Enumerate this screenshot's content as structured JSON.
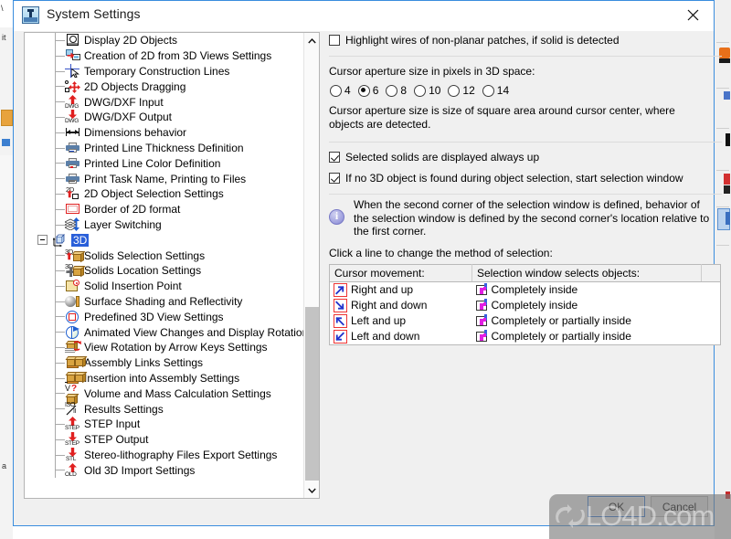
{
  "window": {
    "title": "System Settings",
    "app_icon": "app-window-icon",
    "close_label": "×"
  },
  "tree": {
    "items": [
      {
        "label": "Display 2D Objects",
        "icon": "display-2d-objects-icon",
        "selected": false,
        "indent": 1
      },
      {
        "label": "Creation of 2D from 3D Views Settings",
        "icon": "creation-2d-from-3d-icon",
        "selected": false,
        "indent": 1
      },
      {
        "label": "Temporary Construction Lines",
        "icon": "construction-lines-icon",
        "selected": false,
        "indent": 1
      },
      {
        "label": "2D Objects Dragging",
        "icon": "objects-dragging-icon",
        "selected": false,
        "indent": 1
      },
      {
        "label": "DWG/DXF Input",
        "icon": "dwg-input-icon",
        "selected": false,
        "indent": 1
      },
      {
        "label": "DWG/DXF Output",
        "icon": "dwg-output-icon",
        "selected": false,
        "indent": 1
      },
      {
        "label": "Dimensions behavior",
        "icon": "dimensions-behavior-icon",
        "selected": false,
        "indent": 1
      },
      {
        "label": "Printed Line Thickness Definition",
        "icon": "printer-thickness-icon",
        "selected": false,
        "indent": 1
      },
      {
        "label": "Printed Line Color Definition",
        "icon": "printer-color-icon",
        "selected": false,
        "indent": 1
      },
      {
        "label": "Print Task Name, Printing to Files",
        "icon": "printer-task-icon",
        "selected": false,
        "indent": 1
      },
      {
        "label": "2D Object Selection Settings",
        "icon": "2d-object-selection-icon",
        "selected": false,
        "indent": 1
      },
      {
        "label": "Border of 2D format",
        "icon": "border-2d-format-icon",
        "selected": false,
        "indent": 1
      },
      {
        "label": "Layer Switching",
        "icon": "layer-switching-icon",
        "selected": false,
        "indent": 1
      },
      {
        "label": "3D",
        "icon": "3d-group-icon",
        "selected": true,
        "indent": 0
      },
      {
        "label": "Solids Selection Settings",
        "icon": "solids-selection-icon",
        "selected": false,
        "indent": 1
      },
      {
        "label": "Solids Location Settings",
        "icon": "solids-location-icon",
        "selected": false,
        "indent": 1
      },
      {
        "label": "Solid Insertion Point",
        "icon": "solid-insertion-point-icon",
        "selected": false,
        "indent": 1
      },
      {
        "label": "Surface Shading and Reflectivity",
        "icon": "surface-shading-icon",
        "selected": false,
        "indent": 1
      },
      {
        "label": "Predefined 3D View Settings",
        "icon": "predefined-3d-view-icon",
        "selected": false,
        "indent": 1
      },
      {
        "label": "Animated View Changes and Display Rotation",
        "icon": "animated-view-icon",
        "selected": false,
        "indent": 1
      },
      {
        "label": "View Rotation by Arrow Keys Settings",
        "icon": "view-rotation-arrows-icon",
        "selected": false,
        "indent": 1
      },
      {
        "label": "Assembly Links Settings",
        "icon": "assembly-links-icon",
        "selected": false,
        "indent": 1
      },
      {
        "label": "Insertion into Assembly Settings",
        "icon": "insertion-assembly-icon",
        "selected": false,
        "indent": 1
      },
      {
        "label": "Volume and Mass Calculation Settings",
        "icon": "volume-mass-icon",
        "selected": false,
        "indent": 1
      },
      {
        "label": "Results Settings",
        "icon": "results-settings-icon",
        "selected": false,
        "indent": 1
      },
      {
        "label": "STEP Input",
        "icon": "step-input-icon",
        "selected": false,
        "indent": 1
      },
      {
        "label": "STEP Output",
        "icon": "step-output-icon",
        "selected": false,
        "indent": 1
      },
      {
        "label": "Stereo-lithography Files Export Settings",
        "icon": "stl-export-icon",
        "selected": false,
        "indent": 1
      },
      {
        "label": "Old 3D Import Settings",
        "icon": "old-3d-import-icon",
        "selected": false,
        "indent": 1
      }
    ],
    "scrollbar": {
      "up_arrow": "∧",
      "down_arrow": "∨"
    }
  },
  "settings": {
    "highlight_wires": {
      "label": "Highlight wires of non-planar patches, if solid is detected",
      "checked": false
    },
    "aperture_heading": "Cursor aperture size in pixels in 3D space:",
    "aperture_options": [
      "4",
      "6",
      "8",
      "10",
      "12",
      "14"
    ],
    "aperture_selected": "6",
    "aperture_help": "Cursor aperture size is size of square area around cursor center, where objects are detected.",
    "selected_solids_up": {
      "label": "Selected solids are displayed always up",
      "checked": true
    },
    "start_selection_window": {
      "label": "If no 3D object is found during object selection, start selection window",
      "checked": true
    },
    "info_text": "When the second corner of the selection window is defined, behavior of the selection window is defined by the second corner's location relative to the first corner.",
    "click_line_label": "Click a line to change the method of selection:"
  },
  "selection_table": {
    "headers": [
      "Cursor movement:",
      "Selection window selects objects:",
      ""
    ],
    "rows": [
      {
        "movement": "Right and up",
        "arrow": "arrow-up-right-icon",
        "result": "Completely inside",
        "result_icon": "selection-window-icon"
      },
      {
        "movement": "Right and down",
        "arrow": "arrow-down-right-icon",
        "result": "Completely inside",
        "result_icon": "selection-window-icon"
      },
      {
        "movement": "Left and up",
        "arrow": "arrow-up-left-icon",
        "result": "Completely or partially inside",
        "result_icon": "selection-window-icon"
      },
      {
        "movement": "Left and down",
        "arrow": "arrow-down-left-icon",
        "result": "Completely or partially inside",
        "result_icon": "selection-window-icon"
      }
    ]
  },
  "buttons": {
    "ok": "OK",
    "cancel": "Cancel"
  },
  "watermark": {
    "text": "LO4D.com"
  },
  "colors": {
    "accent": "#3a8dde",
    "selection": "#2a5fd9",
    "red": "#e02020",
    "titlebar": "#ffffff",
    "dialog_bg": "#f0f0f0"
  }
}
